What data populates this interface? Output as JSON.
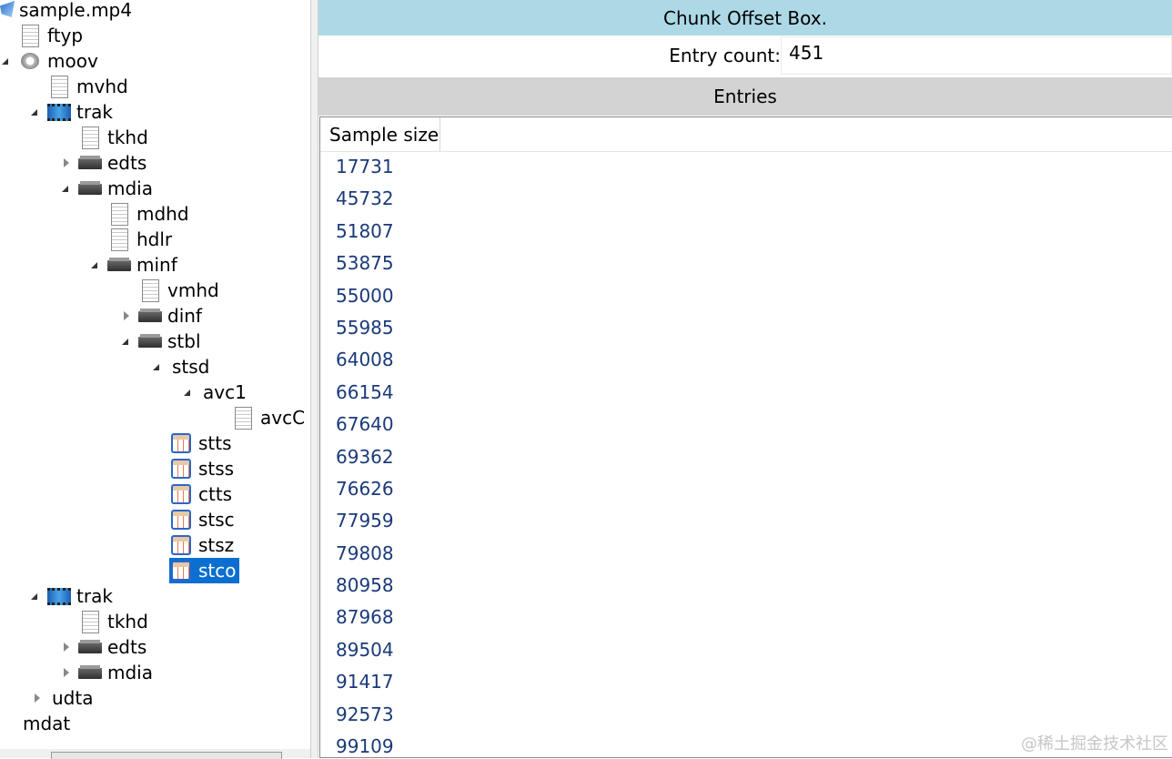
{
  "tree": {
    "nodes": [
      {
        "label": "sample.mp4",
        "icon": "root-icon",
        "toggle": "none"
      },
      {
        "label": "ftyp",
        "icon": "file-icon",
        "toggle": "none"
      },
      {
        "label": "moov",
        "icon": "gear-icon",
        "toggle": "open"
      },
      {
        "label": "mvhd",
        "icon": "file-icon",
        "toggle": "none"
      },
      {
        "label": "trak",
        "icon": "film-icon",
        "toggle": "open"
      },
      {
        "label": "tkhd",
        "icon": "file-icon",
        "toggle": "none"
      },
      {
        "label": "edts",
        "icon": "folder-icon",
        "toggle": "closed"
      },
      {
        "label": "mdia",
        "icon": "folder-icon",
        "toggle": "open"
      },
      {
        "label": "mdhd",
        "icon": "file-icon",
        "toggle": "none"
      },
      {
        "label": "hdlr",
        "icon": "file-icon",
        "toggle": "none"
      },
      {
        "label": "minf",
        "icon": "folder-icon",
        "toggle": "open"
      },
      {
        "label": "vmhd",
        "icon": "file-icon",
        "toggle": "none"
      },
      {
        "label": "dinf",
        "icon": "folder-icon",
        "toggle": "closed"
      },
      {
        "label": "stbl",
        "icon": "folder-icon",
        "toggle": "open"
      },
      {
        "label": "stsd",
        "icon": "none",
        "toggle": "open"
      },
      {
        "label": "avc1",
        "icon": "none",
        "toggle": "open"
      },
      {
        "label": "avcC",
        "icon": "file-icon",
        "toggle": "none"
      },
      {
        "label": "stts",
        "icon": "table-icon",
        "toggle": "none"
      },
      {
        "label": "stss",
        "icon": "table-icon",
        "toggle": "none"
      },
      {
        "label": "ctts",
        "icon": "table-icon",
        "toggle": "none"
      },
      {
        "label": "stsc",
        "icon": "table-icon",
        "toggle": "none"
      },
      {
        "label": "stsz",
        "icon": "table-icon",
        "toggle": "none"
      },
      {
        "label": "stco",
        "icon": "table-icon",
        "toggle": "none",
        "selected": true
      },
      {
        "label": "trak",
        "icon": "film-icon",
        "toggle": "open"
      },
      {
        "label": "tkhd",
        "icon": "file-icon",
        "toggle": "none"
      },
      {
        "label": "edts",
        "icon": "folder-icon",
        "toggle": "closed"
      },
      {
        "label": "mdia",
        "icon": "folder-icon",
        "toggle": "closed"
      },
      {
        "label": "udta",
        "icon": "none",
        "toggle": "closed"
      },
      {
        "label": "mdat",
        "icon": "none",
        "toggle": "none"
      }
    ]
  },
  "panel": {
    "title": "Chunk Offset Box.",
    "entry_count_label": "Entry count:",
    "entry_count_value": "451",
    "entries_header": "Entries",
    "column_header": "Sample size",
    "rows": [
      "17731",
      "45732",
      "51807",
      "53875",
      "55000",
      "55985",
      "64008",
      "66154",
      "67640",
      "69362",
      "76626",
      "77959",
      "79808",
      "80958",
      "87968",
      "89504",
      "91417",
      "92573",
      "99109"
    ]
  },
  "watermark": "@稀土掘金技术社区"
}
